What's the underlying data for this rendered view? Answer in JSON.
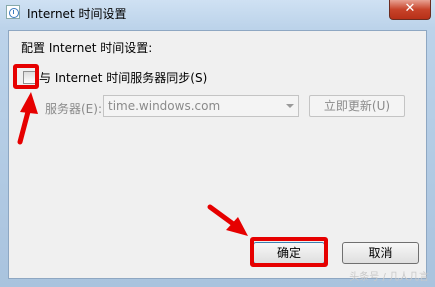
{
  "window": {
    "title": "Internet 时间设置",
    "close_label": "✕"
  },
  "main": {
    "prompt": "配置 Internet 时间设置:",
    "sync_checkbox_label": "与 Internet 时间服务器同步(S)",
    "sync_checked": false,
    "server_label": "服务器(E):",
    "server_value": "time.windows.com",
    "update_button": "立即更新(U)"
  },
  "buttons": {
    "ok": "确定",
    "cancel": "取消"
  },
  "watermark": "头条号 / 几人几言",
  "colors": {
    "annotation": "#e60000"
  }
}
